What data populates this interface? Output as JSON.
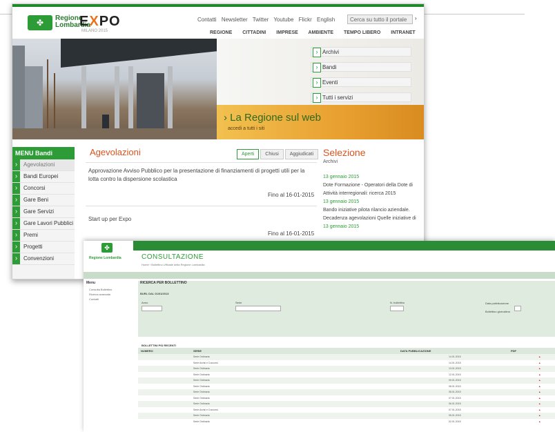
{
  "portal": {
    "logo_text": "Regione Lombardia",
    "expo": {
      "e": "E",
      "x": "X",
      "po": "PO",
      "sub": "MILANO 2015"
    },
    "top_links": [
      "Contatti",
      "Newsletter",
      "Twitter",
      "Youtube",
      "Flickr",
      "English"
    ],
    "search_placeholder": "Cerca su tutto il portale",
    "nav": [
      "REGIONE",
      "CITTADINI",
      "IMPRESE",
      "AMBIENTE",
      "TEMPO LIBERO",
      "INTRANET"
    ],
    "quick_links": [
      "Archivi",
      "Bandi",
      "Eventi",
      "Tutti i servizi"
    ],
    "banner_title": "› La Regione sul web",
    "banner_sub": "accedi a tutti i siti",
    "menu_title": "MENU Bandi",
    "menu_items": [
      "Agevolazioni",
      "Bandi Europei",
      "Concorsi",
      "Gare Beni",
      "Gare Servizi",
      "Gare Lavori Pubblici",
      "Premi",
      "Progetti",
      "Convenzioni"
    ],
    "section_title": "Agevolazioni",
    "tabs": [
      "Aperti",
      "Chiusi",
      "Aggiudicati"
    ],
    "items": [
      {
        "text": "Approvazione Avviso Pubblico per la presentazione di finanziamenti di progetti utili per la lotta contro la dispersione scolastica",
        "date": "Fino al 16-01-2015"
      },
      {
        "text": "Start up per Expo",
        "date": "Fino al 16-01-2015"
      }
    ],
    "selection_title": "Selezione",
    "selection_sub": "Archivi",
    "selection_entries": [
      {
        "date": "13 gennaio 2015",
        "lines": [
          "Dote Formazione - Operatori della Dote di",
          "Attività interregionali: ricerca 2015"
        ]
      },
      {
        "date": "13 gennaio 2015",
        "lines": [
          "Bando iniziative pilota rilancio aziendale.",
          "Decadenza agevolazioni Quelle iniziative di"
        ]
      },
      {
        "date": "13 gennaio 2015",
        "lines": []
      }
    ]
  },
  "consultazione": {
    "logo_text": "Regione Lombardia",
    "title": "CONSULTAZIONE",
    "breadcrumb": "Home › Bollettino Ufficiale della Regione Lombardia",
    "left_head": "Menu",
    "left_items": [
      "Consulta Bollettino",
      "Ricerca avanzata",
      "Contatti"
    ],
    "filter_title": "RICERCA PER BOLLETTINO",
    "filter_sub": "BURL DAL 01/01/2013",
    "filter_labels": {
      "anno": "Anno",
      "serie": "Serie",
      "numero": "N. bollettino",
      "data": "Data pubblicazione",
      "disp": "Bollettino giornaliero"
    },
    "results_title": "BOLLETTINI PIÙ RECENTI",
    "columns": [
      "NUMERO",
      "SERIE",
      "DATA PUBBLICAZIONE",
      "PDF"
    ],
    "rows": [
      {
        "serie": "Serie Ordinaria",
        "data": "14.01.2015",
        "pdf": "▲"
      },
      {
        "serie": "Serie Avvisi e Concorsi",
        "data": "14.01.2015",
        "pdf": "▲"
      },
      {
        "serie": "Serie Ordinaria",
        "data": "13.01.2015",
        "pdf": "▲"
      },
      {
        "serie": "Serie Ordinaria",
        "data": "12.01.2015",
        "pdf": "▲"
      },
      {
        "serie": "Serie Ordinaria",
        "data": "09.01.2015",
        "pdf": "▲"
      },
      {
        "serie": "Serie Ordinaria",
        "data": "08.01.2015",
        "pdf": "▲"
      },
      {
        "serie": "Serie Ordinaria",
        "data": "08.01.2015",
        "pdf": "▲"
      },
      {
        "serie": "Serie Ordinaria",
        "data": "07.01.2015",
        "pdf": "▲"
      },
      {
        "serie": "Serie Ordinaria",
        "data": "06.01.2015",
        "pdf": "▲"
      },
      {
        "serie": "Serie Avvisi e Concorsi",
        "data": "07.01.2015",
        "pdf": "▲"
      },
      {
        "serie": "Serie Ordinaria",
        "data": "05.01.2015",
        "pdf": "▲"
      },
      {
        "serie": "Serie Ordinaria",
        "data": "02.01.2015",
        "pdf": "▲"
      }
    ]
  }
}
